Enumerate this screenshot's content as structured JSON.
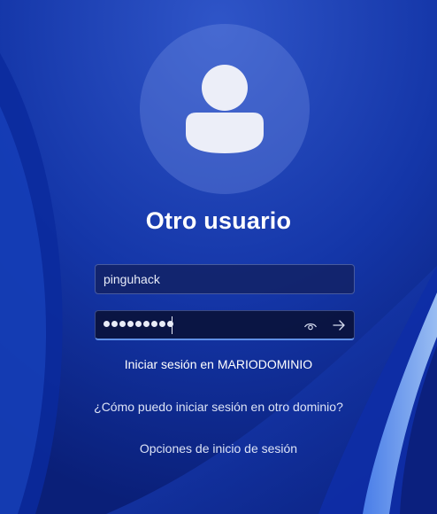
{
  "login": {
    "title": "Otro usuario",
    "username_value": "pinguhack",
    "password_dot_count": 9,
    "sign_in_to_domain": "Iniciar sesión en MARIODOMINIO",
    "other_domain_link": "¿Cómo puedo iniciar sesión en otro dominio?",
    "sign_in_options_link": "Opciones de inicio de sesión"
  },
  "icons": {
    "avatar": "user-silhouette-icon",
    "reveal_password": "eye-icon",
    "submit": "arrow-right-icon"
  },
  "colors": {
    "background": "#0b2a8f",
    "accent_underline": "#5f8fe6",
    "text": "#ffffff"
  }
}
